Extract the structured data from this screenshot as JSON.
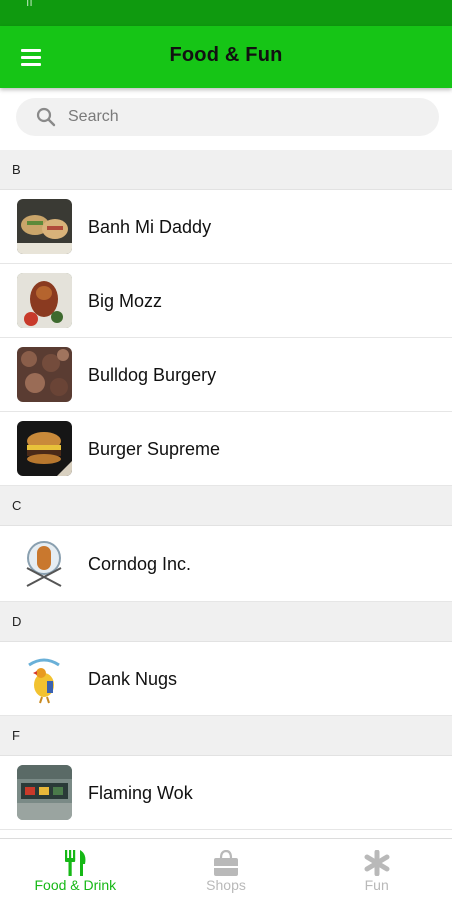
{
  "app": {
    "title": "Food & Fun"
  },
  "search": {
    "placeholder": "Search"
  },
  "sections": [
    {
      "letter": "B",
      "items": [
        "Banh Mi Daddy",
        "Big Mozz",
        "Bulldog Burgery",
        "Burger Supreme"
      ]
    },
    {
      "letter": "C",
      "items": [
        "Corndog Inc."
      ]
    },
    {
      "letter": "D",
      "items": [
        "Dank Nugs"
      ]
    },
    {
      "letter": "F",
      "items": [
        "Flaming Wok"
      ]
    }
  ],
  "tabs": [
    {
      "label": "Food & Drink",
      "icon": "fork-knife-icon",
      "active": true
    },
    {
      "label": "Shops",
      "icon": "shopping-bag-icon",
      "active": false
    },
    {
      "label": "Fun",
      "icon": "asterisk-icon",
      "active": false
    }
  ],
  "colors": {
    "appbar": "#16c516",
    "statusbar": "#0f9a0f",
    "active_tab": "#16b816",
    "inactive_tab": "#b9b9b9"
  }
}
